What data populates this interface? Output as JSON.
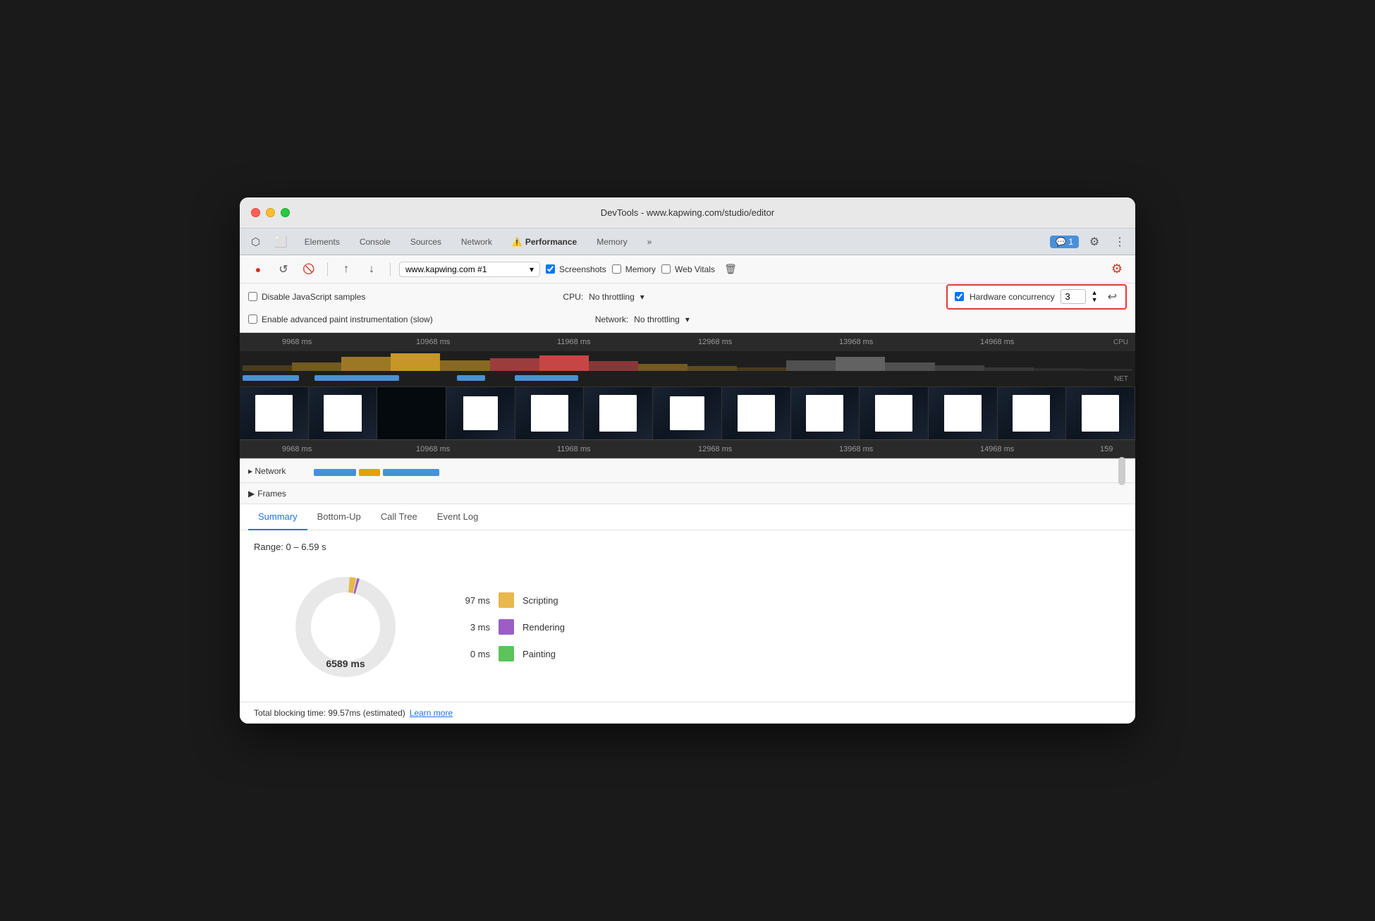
{
  "window": {
    "title": "DevTools - www.kapwing.com/studio/editor"
  },
  "tabs": {
    "items": [
      {
        "label": "Elements",
        "active": false
      },
      {
        "label": "Console",
        "active": false
      },
      {
        "label": "Sources",
        "active": false
      },
      {
        "label": "Network",
        "active": false
      },
      {
        "label": "Performance",
        "active": true,
        "icon": "⚠️"
      },
      {
        "label": "Memory",
        "active": false
      },
      {
        "label": "»",
        "active": false
      }
    ],
    "badge": "1",
    "gear_label": "⚙",
    "more_label": "⋮"
  },
  "toolbar": {
    "record_label": "●",
    "reload_label": "↺",
    "clear_label": "🚫",
    "upload_label": "↑",
    "download_label": "↓",
    "url_value": "www.kapwing.com #1",
    "screenshots_label": "Screenshots",
    "memory_label": "Memory",
    "web_vitals_label": "Web Vitals",
    "trash_label": "🗑",
    "settings_label": "⚙"
  },
  "options": {
    "disable_js_samples": "Disable JavaScript samples",
    "enable_paint": "Enable advanced paint instrumentation (slow)",
    "cpu_label": "CPU:",
    "cpu_throttle": "No throttling",
    "network_label": "Network:",
    "network_throttle": "No throttling",
    "hw_concurrency_label": "Hardware concurrency",
    "hw_concurrency_value": "3",
    "undo_label": "↩"
  },
  "timeline": {
    "ruler_labels": [
      "9968 ms",
      "10968 ms",
      "11968 ms",
      "12968 ms",
      "13968 ms",
      "14968 ms"
    ],
    "ruler_labels_bottom": [
      "9968 ms",
      "10968 ms",
      "11968 ms",
      "12968 ms",
      "13968 ms",
      "14968 ms",
      "159"
    ],
    "cpu_label": "CPU",
    "net_label": "NET"
  },
  "details": {
    "network_label": "▸ Network",
    "frames_label": "▸ Frames"
  },
  "sub_tabs": {
    "items": [
      {
        "label": "Summary",
        "active": true
      },
      {
        "label": "Bottom-Up",
        "active": false
      },
      {
        "label": "Call Tree",
        "active": false
      },
      {
        "label": "Event Log",
        "active": false
      }
    ]
  },
  "summary": {
    "range_text": "Range: 0 – 6.59 s",
    "center_label": "6589 ms",
    "legend": [
      {
        "value": "97 ms",
        "color": "#e8b84b",
        "name": "Scripting"
      },
      {
        "value": "3 ms",
        "color": "#9c5ec5",
        "name": "Rendering"
      },
      {
        "value": "0 ms",
        "color": "#5bc45b",
        "name": "Painting"
      }
    ]
  },
  "footer": {
    "text": "Total blocking time: 99.57ms (estimated)",
    "link_text": "Learn more"
  }
}
